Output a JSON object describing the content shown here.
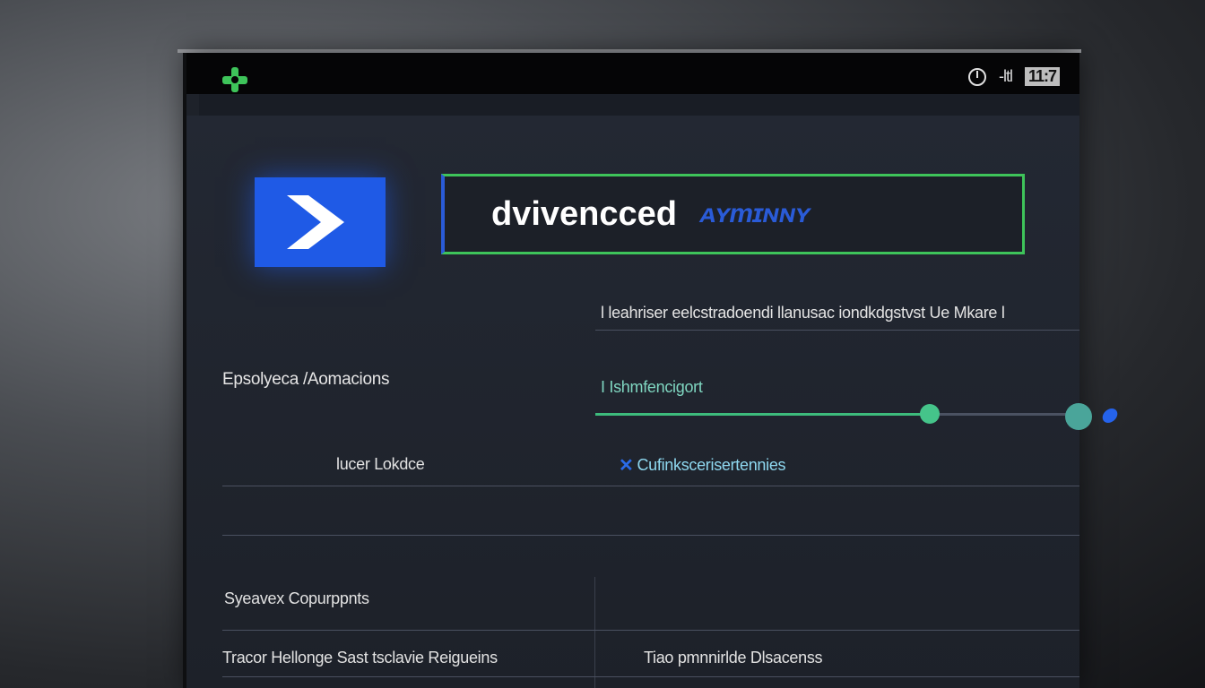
{
  "titlebar": {
    "status_label": "-ltl",
    "status_time": "11:7"
  },
  "search": {
    "value": "dvivencced",
    "accent": "ᴀʏтɪɴɴʏ"
  },
  "description": "l leahriser eelcstradoendi llanusac iondkdgstvst Ue Mkare l",
  "left_label": "Epsolyeca /Aomacions",
  "slider": {
    "label": "I Ishmfencigort",
    "value_fraction": 0.69
  },
  "row1": {
    "label": "lucer Lokdce",
    "link": "Cufinkscerisertennies"
  },
  "row3": {
    "label": "Syeavex Copurppnts"
  },
  "row4": {
    "label": "Tracor Hellonge Sast tsclavie Reigueins",
    "right": "Tiao pmnnirlde Dlsacenss"
  },
  "colors": {
    "accent_blue": "#1f5ae6",
    "accent_green": "#3ec45a"
  },
  "icons": [
    "plus-logo-icon",
    "power-icon",
    "chevron-right-icon",
    "close-icon"
  ]
}
